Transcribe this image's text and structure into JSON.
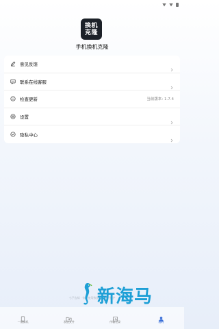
{
  "app": {
    "logo_line1": "换机",
    "logo_line2": "克隆",
    "name": "手机换机克隆"
  },
  "menu": {
    "items": [
      {
        "label": "意见反馈",
        "icon": "edit-icon"
      },
      {
        "label": "联系在线客服",
        "icon": "chat-icon"
      },
      {
        "label": "检查更新",
        "icon": "info-icon",
        "extra": "当前版本: 1.7.4"
      },
      {
        "label": "设置",
        "icon": "settings-icon"
      },
      {
        "label": "隐私中心",
        "icon": "privacy-icon"
      }
    ]
  },
  "bottom_tip": "七子告知 · 你的使用数据已被加密保护",
  "watermark": "新海马",
  "nav": {
    "items": [
      {
        "label": "一键换机",
        "icon": "phone-icon",
        "active": false
      },
      {
        "label": "发送文件",
        "icon": "send-folder-icon",
        "active": false
      },
      {
        "label": "传输记录",
        "icon": "record-icon",
        "active": false
      },
      {
        "label": "我的",
        "icon": "person-icon",
        "active": true
      }
    ]
  },
  "colors": {
    "accent": "#3a6fd8",
    "logo_bg": "#1c2128",
    "watermark": "#1d9fd6"
  }
}
